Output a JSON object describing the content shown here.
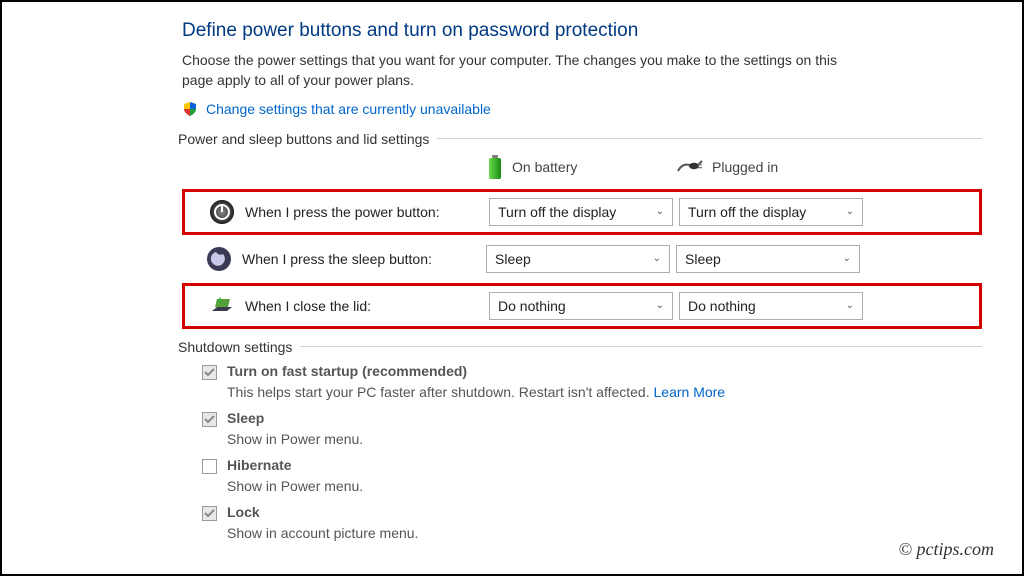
{
  "heading": "Define power buttons and turn on password protection",
  "subtext": "Choose the power settings that you want for your computer. The changes you make to the settings on this page apply to all of your power plans.",
  "change_link": "Change settings that are currently unavailable",
  "section_power": "Power and sleep buttons and lid settings",
  "col_battery": "On battery",
  "col_plugged": "Plugged in",
  "rows": {
    "power": {
      "label": "When I press the power button:",
      "battery": "Turn off the display",
      "plugged": "Turn off the display"
    },
    "sleep": {
      "label": "When I press the sleep button:",
      "battery": "Sleep",
      "plugged": "Sleep"
    },
    "lid": {
      "label": "When I close the lid:",
      "battery": "Do nothing",
      "plugged": "Do nothing"
    }
  },
  "section_shutdown": "Shutdown settings",
  "shutdown": {
    "fast": {
      "label": "Turn on fast startup (recommended)",
      "desc": "This helps start your PC faster after shutdown. Restart isn't affected. ",
      "learn": "Learn More"
    },
    "sleep": {
      "label": "Sleep",
      "desc": "Show in Power menu."
    },
    "hibernate": {
      "label": "Hibernate",
      "desc": "Show in Power menu."
    },
    "lock": {
      "label": "Lock",
      "desc": "Show in account picture menu."
    }
  },
  "watermark": "© pctips.com"
}
